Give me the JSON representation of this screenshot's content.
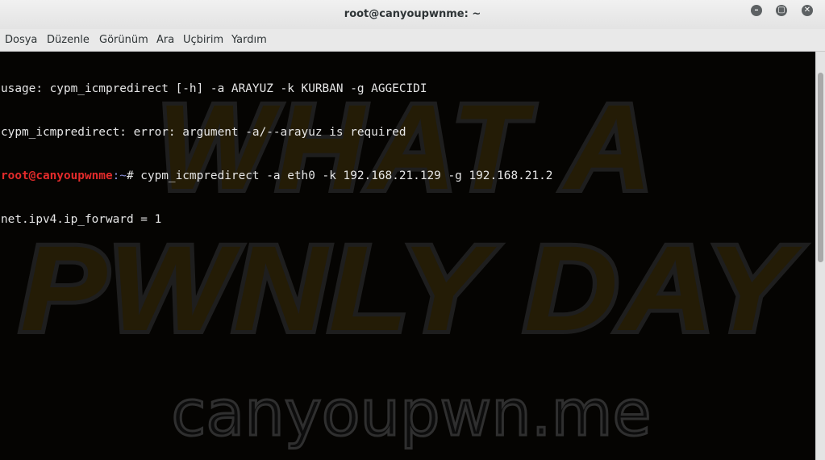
{
  "window": {
    "title": "root@canyoupwnme: ~",
    "minimize_icon": "minimize-icon",
    "maximize_icon": "maximize-icon",
    "close_icon": "close-icon"
  },
  "menubar": {
    "items": [
      "Dosya",
      "Düzenle",
      "Görünüm",
      "Ara",
      "Uçbirim",
      "Yardım"
    ]
  },
  "terminal": {
    "lines": [
      "usage: cypm_icmpredirect [-h] -a ARAYUZ -k KURBAN -g AGGECIDI",
      "cypm_icmpredirect: error: argument -a/--arayuz is required"
    ],
    "prompt_user": "root@canyoupwnme",
    "prompt_path": ":~",
    "prompt_symbol": "# ",
    "command": "cypm_icmpredirect -a eth0 -k 192.168.21.129 -g 192.168.21.2",
    "output": "net.ipv4.ip_forward = 1",
    "colors": {
      "user": "#e32b2b",
      "path": "#8a8fd8",
      "text": "#e6e6e6",
      "background": "#050402"
    }
  },
  "wallpaper": {
    "line1": "WHAT A",
    "line2": "PWNLY DAY",
    "site": "canyoupwn.me",
    "colors": {
      "letters": "#241c06",
      "outline": "#1a1a1a",
      "site": "#2f2f2f"
    }
  }
}
